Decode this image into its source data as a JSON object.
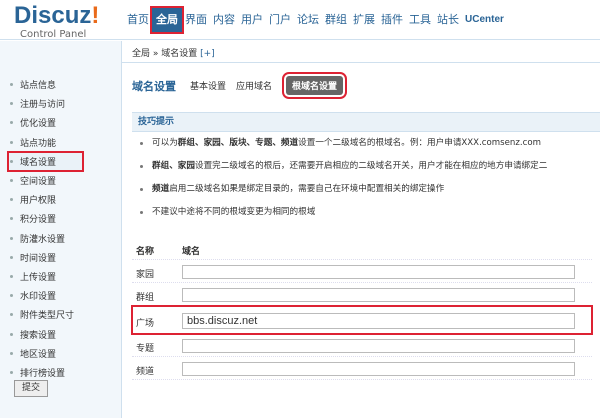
{
  "logo": {
    "brand": "Discuz",
    "bang": "!",
    "sub": "Control Panel"
  },
  "topnav": [
    "首页",
    "全局",
    "界面",
    "内容",
    "用户",
    "门户",
    "论坛",
    "群组",
    "扩展",
    "插件",
    "工具",
    "站长",
    "UCenter"
  ],
  "topnav_active": "全局",
  "breadcrumb": {
    "path": "全局 » 域名设置",
    "plus": "[+]"
  },
  "sidebar": {
    "items": [
      "站点信息",
      "注册与访问",
      "优化设置",
      "站点功能",
      "域名设置",
      "空间设置",
      "用户权限",
      "积分设置",
      "防灌水设置",
      "时间设置",
      "上传设置",
      "水印设置",
      "附件类型尺寸",
      "搜索设置",
      "地区设置",
      "排行榜设置"
    ],
    "active": "域名设置"
  },
  "main": {
    "title": "域名设置",
    "tabs": [
      "基本设置",
      "应用域名",
      "根域名设置"
    ],
    "active_tab": "根域名设置",
    "tips_title": "技巧提示",
    "tips": [
      {
        "bold": "群组、家园、版块、专题、频道",
        "pre": "可以为",
        "post": "设置一个二级域名的根域名。例：用户申请XXX.comsenz.com"
      },
      {
        "bold": "群组、家园",
        "pre": "",
        "post": "设置完二级域名的根后，还需要开启相应的二级域名开关，用户才能在相应的地方申请绑定二"
      },
      {
        "bold": "频道",
        "pre": "",
        "post": "启用二级域名如果是绑定目录的，需要自己在环境中配置相关的绑定操作"
      },
      {
        "bold": "",
        "pre": "不建议中途将不同的根域变更为相同的根域",
        "post": ""
      }
    ],
    "form_head": {
      "name": "名称",
      "domain": "域名"
    },
    "rows": [
      {
        "label": "家园",
        "value": ""
      },
      {
        "label": "群组",
        "value": ""
      },
      {
        "label": "广场",
        "value": "bbs.discuz.net"
      },
      {
        "label": "专题",
        "value": ""
      },
      {
        "label": "频道",
        "value": ""
      }
    ],
    "submit": "提交"
  }
}
